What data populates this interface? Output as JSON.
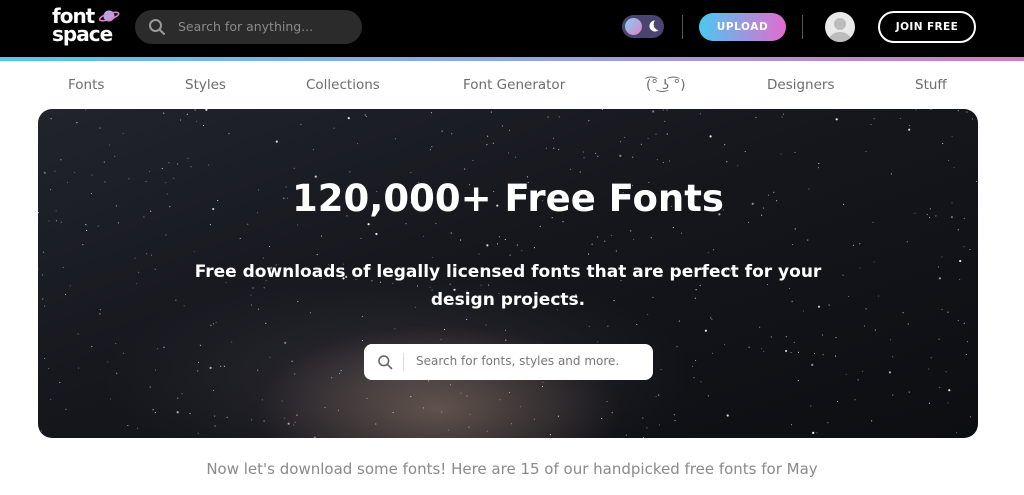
{
  "header": {
    "logo_line1": "font",
    "logo_line2": "space",
    "search_placeholder": "Search for anything...",
    "upload_label": "UPLOAD",
    "join_label": "JOIN FREE"
  },
  "nav": {
    "items": [
      "Fonts",
      "Styles",
      "Collections",
      "Font Generator",
      "(͡° ͜ʖ ͡°)",
      "Designers",
      "Stuff"
    ]
  },
  "hero": {
    "title": "120,000+ Free Fonts",
    "subtitle": "Free downloads of legally licensed fonts that are perfect for your design projects.",
    "search_placeholder": "Search for fonts, styles and more."
  },
  "featured_intro": "Now let's download some fonts! Here are 15 of our handpicked free fonts for May",
  "colors": {
    "topbar": "#000000",
    "accent_blue": "#4cc8f0",
    "accent_pink": "#e46ad0"
  }
}
